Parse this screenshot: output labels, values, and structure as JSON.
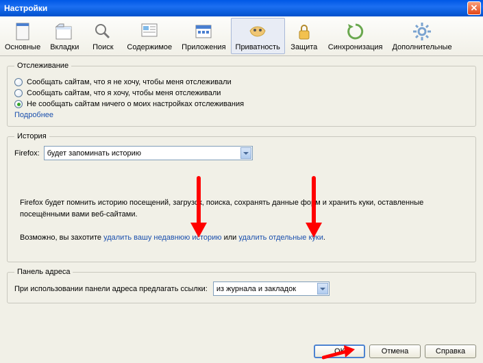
{
  "window": {
    "title": "Настройки"
  },
  "toolbar": [
    {
      "id": "general",
      "label": "Основные",
      "selected": false
    },
    {
      "id": "tabs",
      "label": "Вкладки",
      "selected": false
    },
    {
      "id": "search",
      "label": "Поиск",
      "selected": false
    },
    {
      "id": "content",
      "label": "Содержимое",
      "selected": false
    },
    {
      "id": "applications",
      "label": "Приложения",
      "selected": false
    },
    {
      "id": "privacy",
      "label": "Приватность",
      "selected": true
    },
    {
      "id": "security",
      "label": "Защита",
      "selected": false
    },
    {
      "id": "sync",
      "label": "Синхронизация",
      "selected": false
    },
    {
      "id": "advanced",
      "label": "Дополнительные",
      "selected": false
    }
  ],
  "tracking": {
    "legend": "Отслеживание",
    "opt1": "Сообщать сайтам, что я не хочу, чтобы меня отслеживали",
    "opt2": "Сообщать сайтам, что я хочу, чтобы меня отслеживали",
    "opt3": "Не сообщать сайтам ничего о моих настройках отслеживания",
    "more": "Подробнее"
  },
  "history": {
    "legend": "История",
    "label": "Firefox:",
    "selected": "будет запоминать историю",
    "desc": "Firefox будет помнить историю посещений, загрузок, поиска, сохранять данные форм и хранить куки, оставленные посещёнными вами веб-сайтами.",
    "maybe_pre": "Возможно, вы захотите ",
    "link1": "удалить вашу недавнюю историю",
    "mid": " или ",
    "link2": "удалить отдельные куки",
    "end": "."
  },
  "address": {
    "legend": "Панель адреса",
    "label": "При использовании панели адреса предлагать ссылки:",
    "selected": "из журнала и закладок"
  },
  "buttons": {
    "ok": "ОК",
    "cancel": "Отмена",
    "help": "Справка"
  }
}
